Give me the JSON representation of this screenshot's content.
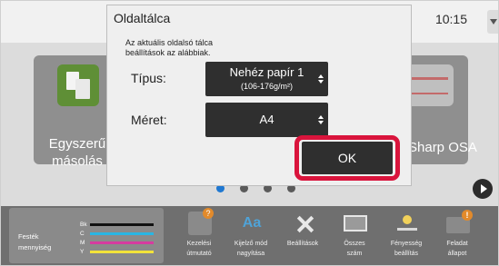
{
  "status_bar": {
    "time": "10:15"
  },
  "home": {
    "tiles": [
      {
        "label": "Egyszerű másolás",
        "icon": "copy-icon"
      },
      {
        "label": "Sharp OSA",
        "icon": "sharp-osa-icon"
      }
    ],
    "page_dots": {
      "count": 4,
      "active_index": 0
    }
  },
  "dialog": {
    "title": "Oldaltálca",
    "description_line1": "Az aktuális oldalsó tálca",
    "description_line2": "beállítások az alábbiak.",
    "type_label": "Típus:",
    "type_value": "Nehéz papír 1",
    "type_subvalue": "(106-176g/m²)",
    "size_label": "Méret:",
    "size_value": "A4",
    "ok_label": "OK"
  },
  "bottom_bar": {
    "toner": {
      "label_line1": "Festék",
      "label_line2": "mennyiség",
      "channels": [
        {
          "letter": "Bk",
          "color": "#111111"
        },
        {
          "letter": "C",
          "color": "#29b6e3"
        },
        {
          "letter": "M",
          "color": "#d63ba0"
        },
        {
          "letter": "Y",
          "color": "#f2e23a"
        }
      ]
    },
    "items": [
      {
        "line1": "Kezelési",
        "line2": "útmutató",
        "icon": "help-guide-icon"
      },
      {
        "line1": "Kijelző mód",
        "line2": "nagyítása",
        "icon": "display-zoom-icon"
      },
      {
        "line1": "Beállítások",
        "line2": "",
        "icon": "settings-icon"
      },
      {
        "line1": "Összes",
        "line2": "szám",
        "icon": "totals-counter-icon"
      },
      {
        "line1": "Fényesség",
        "line2": "beállítás",
        "icon": "brightness-icon"
      },
      {
        "line1": "Feladat",
        "line2": "állapot",
        "icon": "job-status-icon"
      }
    ]
  },
  "colors": {
    "highlight": "#d9143c",
    "accent_dot": "#1f78d1"
  }
}
